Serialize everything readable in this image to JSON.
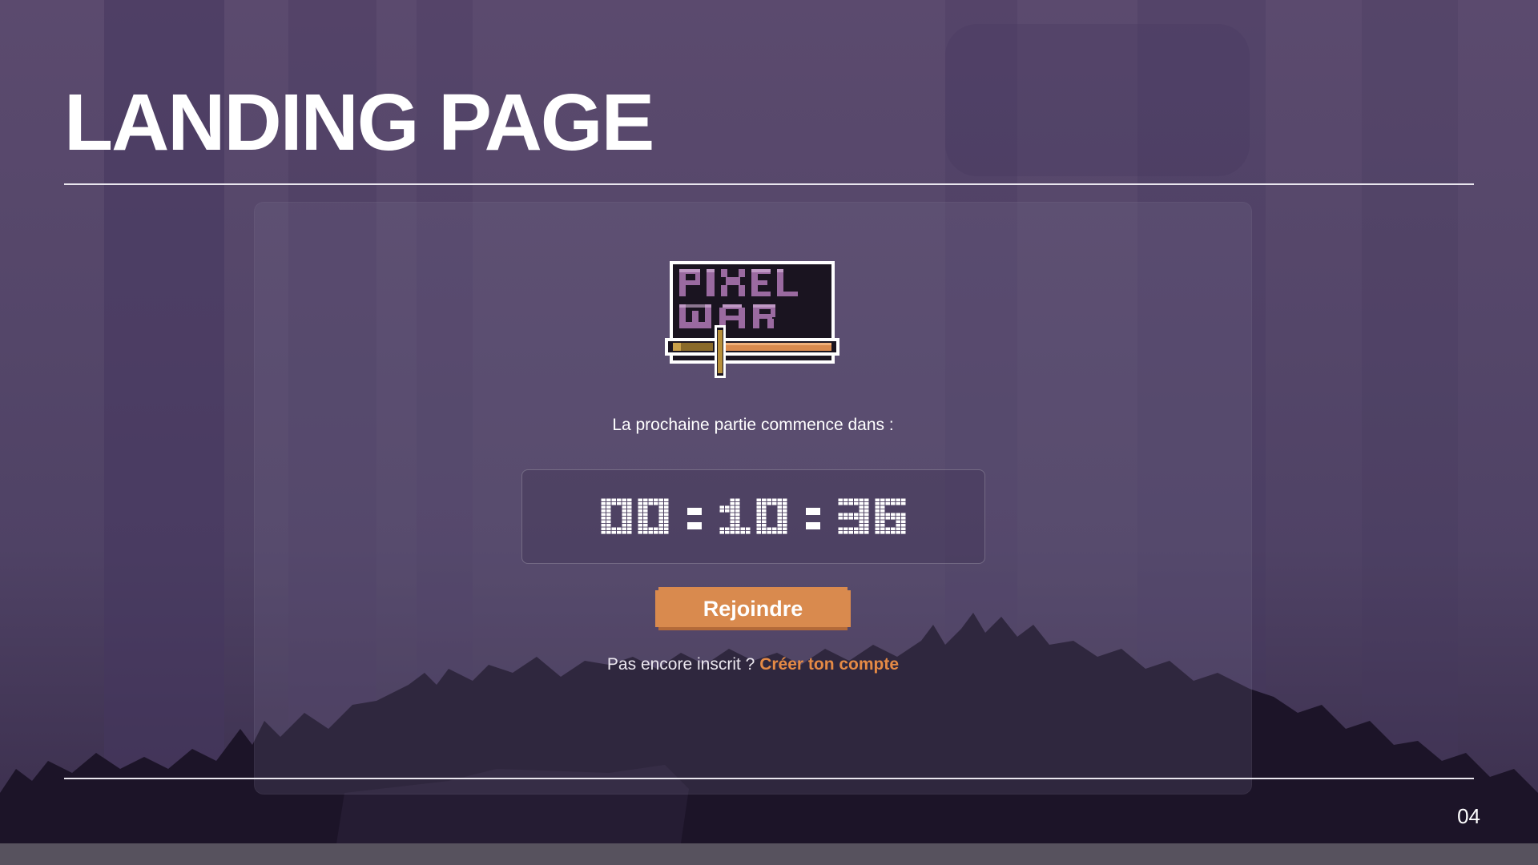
{
  "slide": {
    "title": "LANDING PAGE",
    "page_number": "04"
  },
  "game": {
    "logo_text": "PIXEL WAR",
    "countdown_label": "La prochaine partie commence dans :",
    "countdown": {
      "hours": "00",
      "minutes": "10",
      "seconds": "36",
      "separator": ":"
    },
    "join_button_label": "Rejoindre",
    "signup_prompt": "Pas encore inscrit ?",
    "signup_link_label": "Créer ton compte"
  },
  "colors": {
    "accent_orange": "#d98a4e",
    "link_orange": "#e58a45",
    "background_purple": "#544669",
    "foliage_dark": "#1c1428"
  }
}
